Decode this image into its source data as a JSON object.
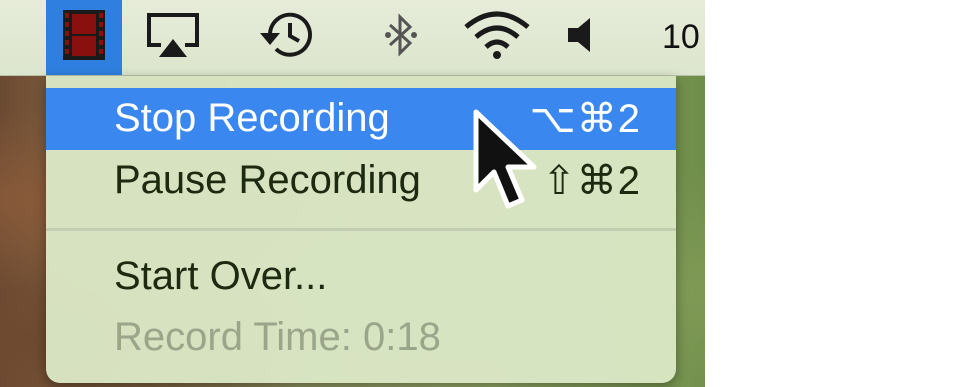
{
  "menubar": {
    "items": [
      {
        "icon": "film-strip-icon"
      },
      {
        "icon": "airplay-icon"
      },
      {
        "icon": "time-machine-icon"
      },
      {
        "icon": "bluetooth-icon"
      },
      {
        "icon": "wifi-icon"
      },
      {
        "icon": "volume-icon"
      }
    ],
    "clock": "10",
    "highlight_color": "#2f7fe0"
  },
  "menu": {
    "stop": {
      "label": "Stop Recording",
      "shortcut": "⌥⌘2"
    },
    "pause": {
      "label": "Pause Recording",
      "shortcut": "⇧⌘2"
    },
    "start_over": {
      "label": "Start Over..."
    },
    "record_time": {
      "label": "Record Time: 0:18"
    },
    "highlight_color": "#3b87f0"
  }
}
